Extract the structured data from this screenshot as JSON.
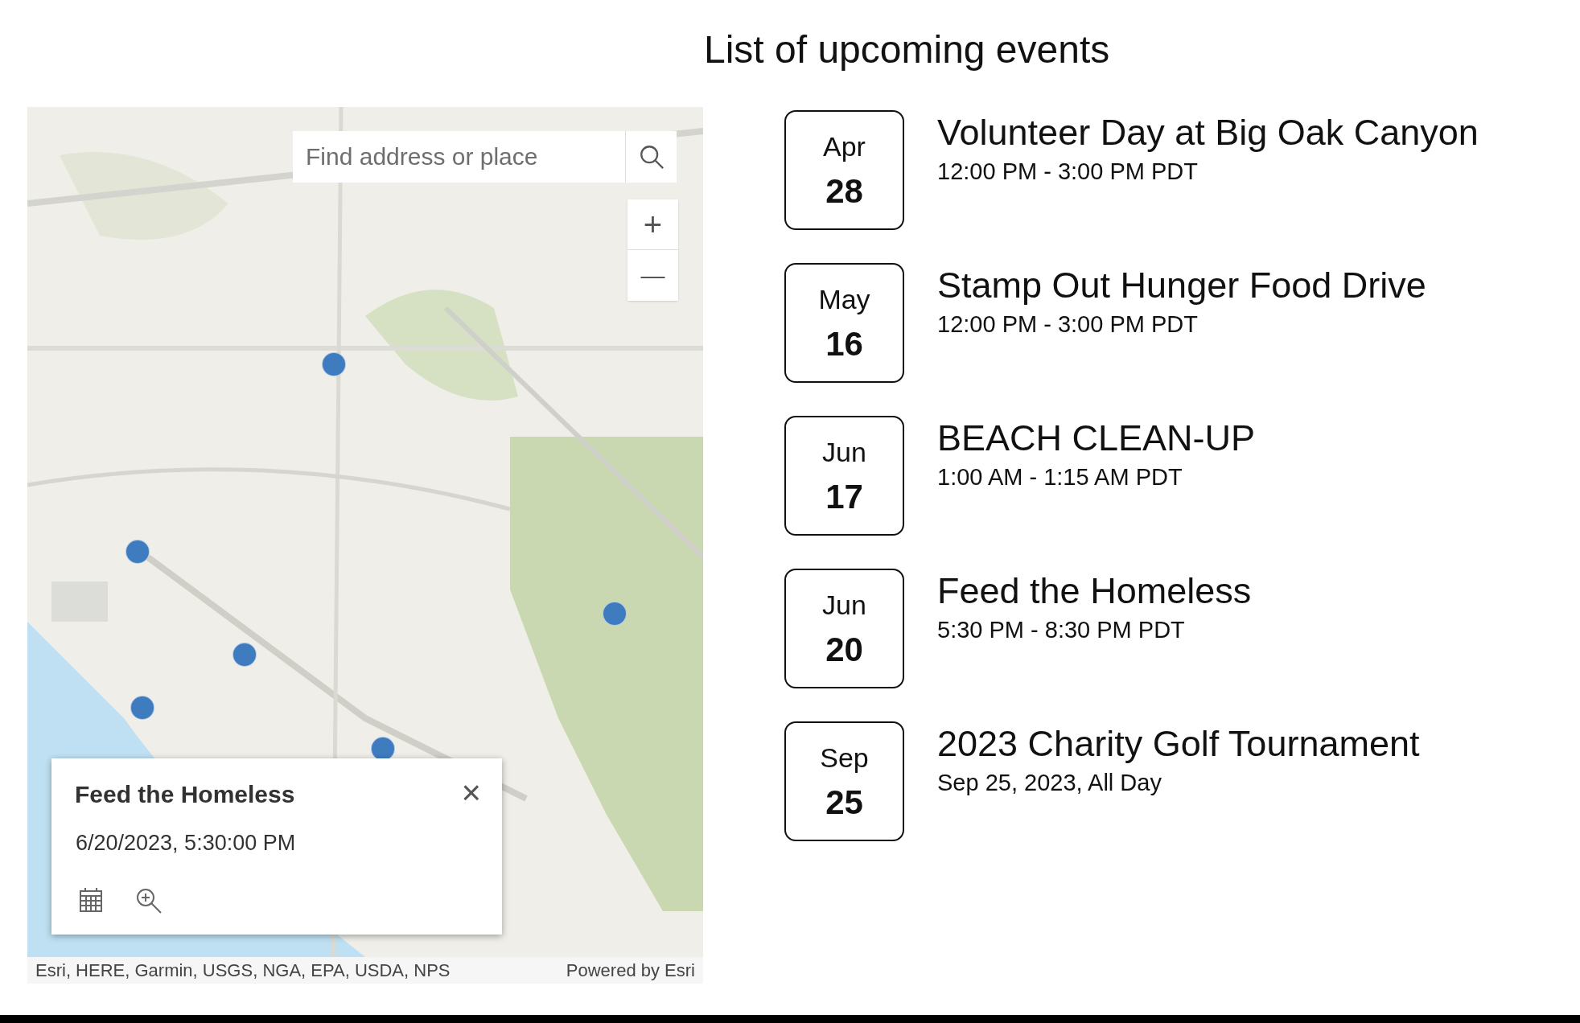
{
  "heading": "List of upcoming events",
  "map": {
    "search": {
      "placeholder": "Find address or place"
    },
    "zoom_in": "+",
    "zoom_out": "—",
    "popup": {
      "title": "Feed the Homeless",
      "datetime": "6/20/2023, 5:30:00 PM",
      "close": "×"
    },
    "attribution": "Esri, HERE, Garmin, USGS, NGA, EPA, USDA, NPS",
    "powered_by": "Powered by Esri"
  },
  "events": [
    {
      "month": "Apr",
      "day": "28",
      "title": "Volunteer Day at Big Oak Canyon",
      "time": "12:00 PM - 3:00 PM PDT"
    },
    {
      "month": "May",
      "day": "16",
      "title": "Stamp Out Hunger Food Drive",
      "time": "12:00 PM - 3:00 PM PDT"
    },
    {
      "month": "Jun",
      "day": "17",
      "title": "BEACH CLEAN-UP",
      "time": "1:00 AM - 1:15 AM PDT"
    },
    {
      "month": "Jun",
      "day": "20",
      "title": "Feed the Homeless",
      "time": "5:30 PM - 8:30 PM PDT"
    },
    {
      "month": "Sep",
      "day": "25",
      "title": "2023 Charity Golf Tournament",
      "time": "Sep 25, 2023, All Day"
    }
  ]
}
